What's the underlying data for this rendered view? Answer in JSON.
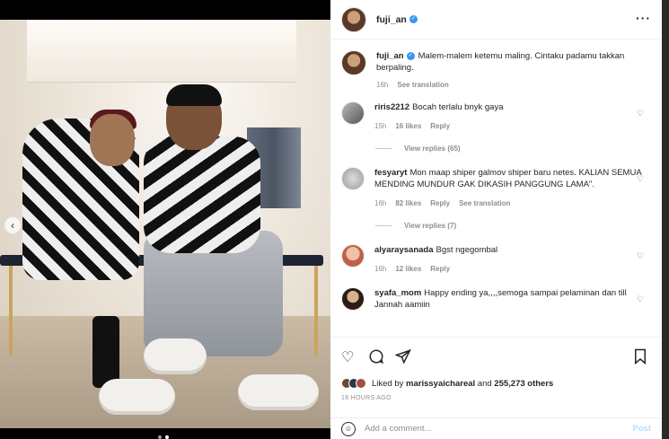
{
  "post": {
    "username": "fuji_an",
    "more_icon": "more-horizontal-icon",
    "caption": {
      "username": "fuji_an",
      "text": "Malem-malem ketemu maling. Cintaku padamu takkan berpaling.",
      "time": "16h",
      "translate": "See translation"
    }
  },
  "comments": [
    {
      "username": "riris2212",
      "text": "Bocah terlalu bnyk gaya",
      "time": "15h",
      "likes": "16 likes",
      "reply": "Reply",
      "view_replies": "View replies (65)"
    },
    {
      "username": "fesyaryt",
      "text": "Mon maap shiper galmov shiper baru netes. KALIAN SEMUA MENDING MUNDUR GAK DIKASIH PANGGUNG LAMA\".",
      "time": "16h",
      "likes": "82 likes",
      "reply": "Reply",
      "translate": "See translation",
      "view_replies": "View replies (7)"
    },
    {
      "username": "alyaraysanada",
      "text": "Bgst ngegombal",
      "time": "16h",
      "likes": "12 likes",
      "reply": "Reply"
    },
    {
      "username": "syafa_mom",
      "text": "Happy ending ya,,,,semoga sampai pelaminan dan till Jannah aamiin"
    }
  ],
  "likes_summary": {
    "prefix": "Liked by",
    "user": "marissyaichareal",
    "middle": "and",
    "count": "255,273 others"
  },
  "timestamp": "16 HOURS AGO",
  "add_comment": {
    "placeholder": "Add a comment...",
    "post_label": "Post"
  },
  "colors": {
    "accent_blue": "#3897f0",
    "post_disabled": "#b2dffc",
    "muted": "#8e8e8e"
  }
}
